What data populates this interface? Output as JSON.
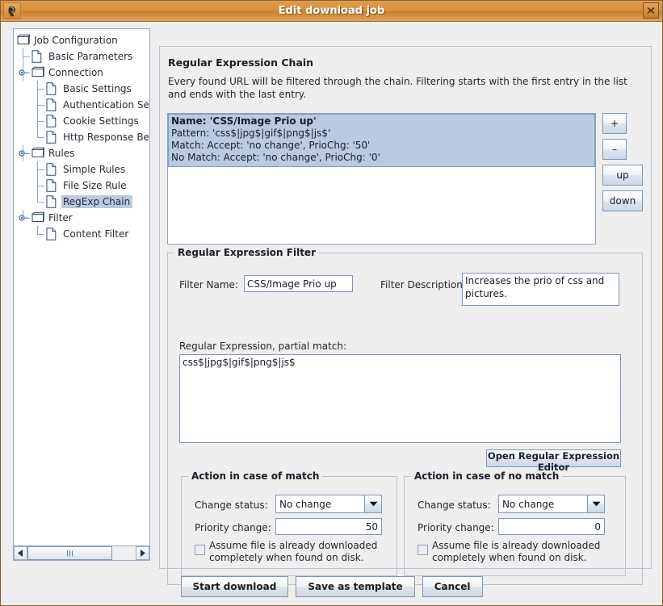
{
  "window": {
    "title": "Edit download job",
    "app_icon": "app-swirl-icon",
    "close_icon": "close-icon"
  },
  "tree": {
    "items": [
      {
        "label": "Job Configuration",
        "depth": 0,
        "icon": "folder-icon",
        "handle": "none",
        "selected": false
      },
      {
        "label": "Basic Parameters",
        "depth": 1,
        "icon": "file-icon",
        "handle": "none",
        "selected": false
      },
      {
        "label": "Connection",
        "depth": 1,
        "icon": "folder-icon",
        "handle": "expanded",
        "selected": false
      },
      {
        "label": "Basic Settings",
        "depth": 2,
        "icon": "file-icon",
        "handle": "none",
        "selected": false
      },
      {
        "label": "Authentication Settings",
        "depth": 2,
        "icon": "file-icon",
        "handle": "none",
        "selected": false
      },
      {
        "label": "Cookie Settings",
        "depth": 2,
        "icon": "file-icon",
        "handle": "none",
        "selected": false
      },
      {
        "label": "Http Response Behaviour",
        "depth": 2,
        "icon": "file-icon",
        "handle": "none",
        "selected": false
      },
      {
        "label": "Rules",
        "depth": 1,
        "icon": "folder-icon",
        "handle": "expanded",
        "selected": false
      },
      {
        "label": "Simple Rules",
        "depth": 2,
        "icon": "file-icon",
        "handle": "none",
        "selected": false
      },
      {
        "label": "File Size Rule",
        "depth": 2,
        "icon": "file-icon",
        "handle": "none",
        "selected": false
      },
      {
        "label": "RegExp Chain",
        "depth": 2,
        "icon": "file-icon",
        "handle": "none",
        "selected": true
      },
      {
        "label": "Filter",
        "depth": 1,
        "icon": "folder-icon",
        "handle": "expanded",
        "selected": false
      },
      {
        "label": "Content Filter",
        "depth": 2,
        "icon": "file-icon",
        "handle": "none",
        "selected": false
      }
    ],
    "scrollbar": {
      "left_arrow_icon": "arrow-left-icon",
      "right_arrow_icon": "arrow-right-icon",
      "grip_icon": "grip-icon"
    }
  },
  "content": {
    "heading": "Regular Expression Chain",
    "description": "Every found URL will be filtered through the chain. Filtering starts with the first entry in the list and ends with the last entry.",
    "chain_entries": [
      {
        "selected": true,
        "lines": [
          "Name: 'CSS/Image Prio up'",
          "Pattern: 'css$|jpg$|gif$|png$|js$'",
          "Match: Accept: 'no change', PrioChg: '50'",
          "No Match: Accept: 'no change', PrioChg: '0'"
        ]
      }
    ],
    "side_buttons": [
      {
        "label": "+",
        "name": "add-entry-button"
      },
      {
        "label": "–",
        "name": "remove-entry-button"
      },
      {
        "label": "up",
        "name": "move-up-button"
      },
      {
        "label": "down",
        "name": "move-down-button"
      }
    ]
  },
  "filter": {
    "group_title": "Regular Expression Filter",
    "filter_name_label": "Filter Name:",
    "filter_name_value": "CSS/Image Prio up",
    "filter_description_label": "Filter Description:",
    "filter_description_value": "Increases the prio of css and pictures.",
    "regex_label": "Regular Expression, partial match:",
    "regex_value": "css$|jpg$|gif$|png$|js$",
    "open_editor_button": "Open Regular Expression Editor"
  },
  "match_action": {
    "group_title": "Action in case of match",
    "change_status_label": "Change status:",
    "change_status_value": "No change",
    "priority_label": "Priority change:",
    "priority_value": "50",
    "assume_checkbox_label": "Assume file is already downloaded\ncompletely when found on disk.",
    "assume_checked": false,
    "dropdown_icon": "chevron-down-icon"
  },
  "nomatch_action": {
    "group_title": "Action in case of no match",
    "change_status_label": "Change status:",
    "change_status_value": "No change",
    "priority_label": "Priority change:",
    "priority_value": "0",
    "assume_checkbox_label": "Assume file is already downloaded\ncompletely when found on disk.",
    "assume_checked": false,
    "dropdown_icon": "chevron-down-icon"
  },
  "footer": {
    "start_download": "Start download",
    "save_as_template": "Save as template",
    "cancel": "Cancel"
  },
  "colors": {
    "titlebar_orange": "#d9913f",
    "selection_blue": "#b8cbe2",
    "panel_gray": "#eeeeee",
    "border_blue": "#7d96b8"
  }
}
